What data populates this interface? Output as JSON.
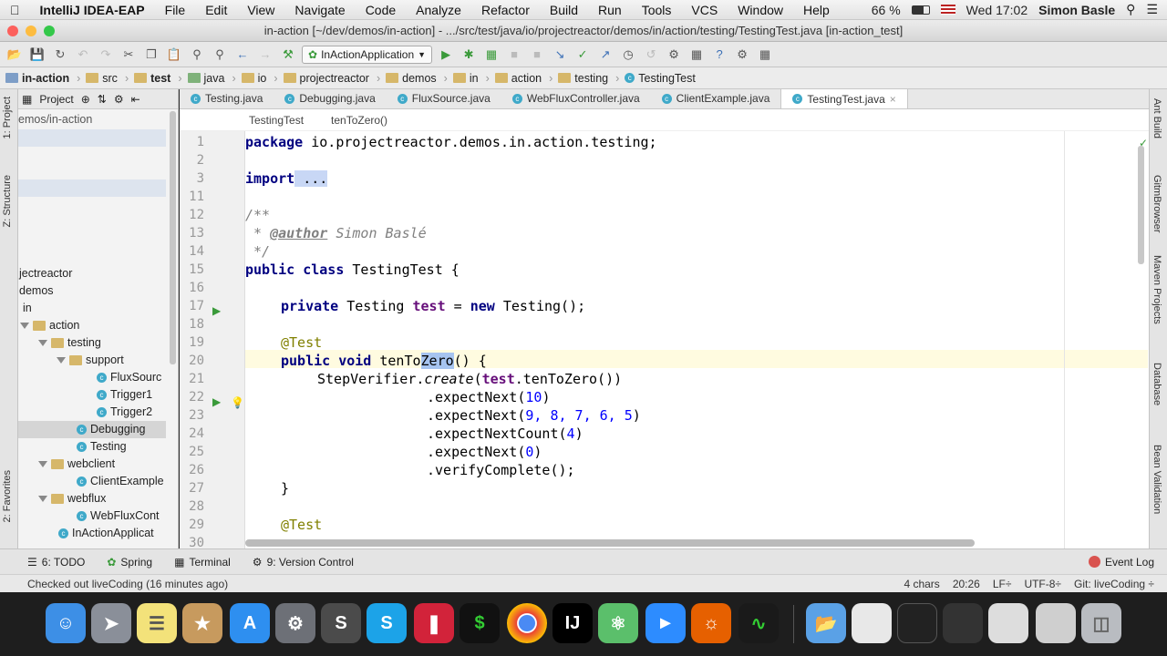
{
  "menubar": {
    "app_name": "IntelliJ IDEA-EAP",
    "items": [
      "File",
      "Edit",
      "View",
      "Navigate",
      "Code",
      "Analyze",
      "Refactor",
      "Build",
      "Run",
      "Tools",
      "VCS",
      "Window",
      "Help"
    ],
    "battery": "66 %",
    "clock": "Wed 17:02",
    "user": "Simon Basle"
  },
  "window": {
    "title": "in-action [~/dev/demos/in-action] - .../src/test/java/io/projectreactor/demos/in/action/testing/TestingTest.java [in-action_test]"
  },
  "toolbar": {
    "run_config": "InActionApplication"
  },
  "navbar": {
    "crumbs": [
      "in-action",
      "src",
      "test",
      "java",
      "io",
      "projectreactor",
      "demos",
      "in",
      "action",
      "testing",
      "TestingTest"
    ]
  },
  "left_strip": {
    "tabs": [
      "1: Project",
      "Z: Structure",
      "2: Favorites"
    ]
  },
  "project_panel": {
    "header_label": "Project",
    "path_fragment": "emos/in-action",
    "tree": [
      {
        "label": "jectreactor",
        "level": 0,
        "kind": "text"
      },
      {
        "label": "demos",
        "level": 0,
        "kind": "text"
      },
      {
        "label": "in",
        "level": 0,
        "kind": "text"
      },
      {
        "label": "action",
        "level": 1,
        "kind": "folder"
      },
      {
        "label": "testing",
        "level": 2,
        "kind": "folder"
      },
      {
        "label": "support",
        "level": 3,
        "kind": "folder"
      },
      {
        "label": "FluxSourc",
        "level": 4,
        "kind": "class"
      },
      {
        "label": "Trigger1",
        "level": 4,
        "kind": "class"
      },
      {
        "label": "Trigger2",
        "level": 4,
        "kind": "class"
      },
      {
        "label": "Debugging",
        "level": 3,
        "kind": "class",
        "selected": true
      },
      {
        "label": "Testing",
        "level": 3,
        "kind": "class"
      },
      {
        "label": "webclient",
        "level": 2,
        "kind": "folder"
      },
      {
        "label": "ClientExample",
        "level": 3,
        "kind": "class"
      },
      {
        "label": "webflux",
        "level": 2,
        "kind": "folder"
      },
      {
        "label": "WebFluxCont",
        "level": 3,
        "kind": "class"
      },
      {
        "label": "InActionApplicat",
        "level": 2,
        "kind": "class"
      }
    ]
  },
  "editor": {
    "tabs": [
      "Testing.java",
      "Debugging.java",
      "FluxSource.java",
      "WebFluxController.java",
      "ClientExample.java",
      "TestingTest.java"
    ],
    "active_tab": "TestingTest.java",
    "breadcrumb": [
      "TestingTest",
      "tenToZero()"
    ],
    "line_numbers": [
      "1",
      "2",
      "3",
      "11",
      "12",
      "13",
      "14",
      "15",
      "16",
      "17",
      "18",
      "19",
      "20",
      "21",
      "22",
      "23",
      "24",
      "25",
      "26",
      "27",
      "28",
      "29",
      "30"
    ],
    "code": {
      "l1_kw": "package",
      "l1_rest": " io.projectreactor.demos.in.action.testing;",
      "l3_kw": "import",
      "l3_rest": " ...",
      "l12": "/**",
      "l13_pre": " * ",
      "l13_tag": "@author",
      "l13_rest": " Simon Baslé",
      "l14": " */",
      "l15_kw": "public class",
      "l15_rest": " TestingTest {",
      "l17_kw": "private",
      "l17_mid": " Testing ",
      "l17_fld": "test",
      "l17_eq": " = ",
      "l17_kw2": "new",
      "l17_end": " Testing();",
      "l19_ann": "@Test",
      "l20_kw": "public void",
      "l20_pre": " tenTo",
      "l20_sel": "Zero",
      "l20_end": "() {",
      "l21_a": "StepVerifier.",
      "l21_m": "create",
      "l21_b": "(",
      "l21_f": "test",
      "l21_c": ".tenToZero())",
      "l22_a": ".expectNext(",
      "l22_n": "10",
      "l22_b": ")",
      "l23_a": ".expectNext(",
      "l23_n": "9, 8, 7, 6, 5",
      "l23_b": ")",
      "l24_a": ".expectNextCount(",
      "l24_n": "4",
      "l24_b": ")",
      "l25_a": ".expectNext(",
      "l25_n": "0",
      "l25_b": ")",
      "l26": ".verifyComplete();",
      "l27": "}",
      "l29_ann": "@Test"
    }
  },
  "right_strip": {
    "tabs": [
      "Ant Build",
      "GitmBrowser",
      "Maven Projects",
      "Database",
      "Bean Validation"
    ]
  },
  "toolwindows": [
    "6: TODO",
    "Spring",
    "Terminal",
    "9: Version Control"
  ],
  "event_log": "Event Log",
  "status": {
    "message": "Checked out liveCoding (16 minutes ago)",
    "chars": "4 chars",
    "position": "20:26",
    "line_sep": "LF÷",
    "encoding": "UTF-8÷",
    "git": "Git: liveCoding ÷"
  },
  "dock": {
    "apps": [
      "Finder",
      "Launchpad",
      "Notes",
      "Preview",
      "App Store",
      "System Preferences",
      "Sublime Text",
      "Skype",
      "Hangouts",
      "iTerm",
      "Chrome",
      "IntelliJ IDEA",
      "Atom",
      "Zoom",
      "Firefox",
      "Activity Monitor"
    ]
  },
  "colors": {
    "accent": "#3fa9c9",
    "keyword": "#000080",
    "annotation": "#808000",
    "number": "#0000ff",
    "field": "#660e7a",
    "selection": "#c8d7f5"
  }
}
